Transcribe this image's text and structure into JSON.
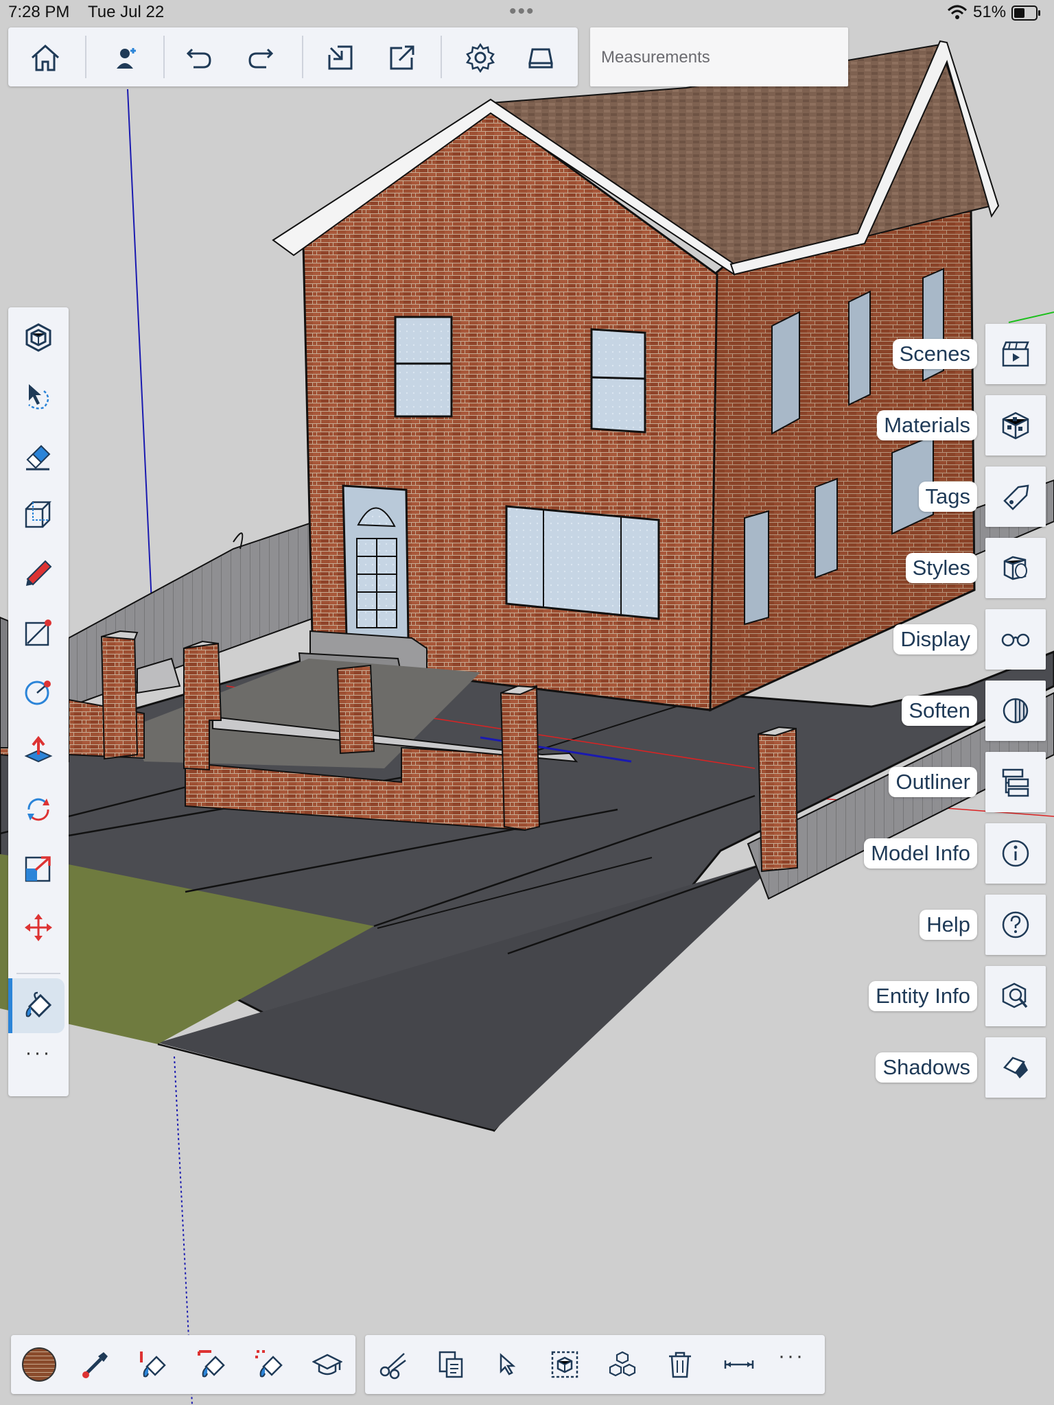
{
  "status_bar": {
    "time": "7:28 PM",
    "date": "Tue Jul 22",
    "handle": "•••",
    "battery": "51%"
  },
  "toolbar": {
    "measurements_placeholder": "Measurements",
    "icons": [
      "home-icon",
      "add-person-icon",
      "undo-icon",
      "redo-icon",
      "import-icon",
      "export-icon",
      "settings-icon",
      "storage-icon"
    ]
  },
  "left_toolbar": {
    "icons": [
      "components-icon",
      "select-icon",
      "eraser-icon",
      "shape-icon",
      "pencil-icon",
      "line-icon",
      "circle-icon",
      "push-pull-icon",
      "rotate-icon",
      "scale-icon",
      "move-icon",
      "paint-bucket-icon"
    ],
    "more": "···"
  },
  "panels": [
    {
      "label": "Scenes",
      "icon": "scenes-icon"
    },
    {
      "label": "Materials",
      "icon": "materials-icon"
    },
    {
      "label": "Tags",
      "icon": "tags-icon"
    },
    {
      "label": "Styles",
      "icon": "styles-icon"
    },
    {
      "label": "Display",
      "icon": "display-icon"
    },
    {
      "label": "Soften",
      "icon": "soften-icon"
    },
    {
      "label": "Outliner",
      "icon": "outliner-icon"
    },
    {
      "label": "Model Info",
      "icon": "model-info-icon"
    },
    {
      "label": "Help",
      "icon": "help-icon"
    },
    {
      "label": "Entity Info",
      "icon": "entity-info-icon"
    },
    {
      "label": "Shadows",
      "icon": "shadows-icon"
    }
  ],
  "bottom_toolbar": {
    "material_icons": [
      "material-swatch-icon",
      "eyedropper-icon",
      "paint-adjacent-icon",
      "paint-connected-icon",
      "paint-object-icon",
      "learn-icon"
    ],
    "edit_icons": [
      "cut-icon",
      "copy-icon",
      "select-arrow-icon",
      "select-box-icon",
      "components-cubes-icon",
      "delete-icon",
      "dimension-icon"
    ],
    "more": "···"
  },
  "colors": {
    "accent": "#2b84d8",
    "icon_blue": "#1f3a57",
    "brick": "#9a4a2e",
    "roof": "#7f6251",
    "pavement": "#4a4b50",
    "grass": "#6e7a3e",
    "background": "#cfcfcf"
  }
}
